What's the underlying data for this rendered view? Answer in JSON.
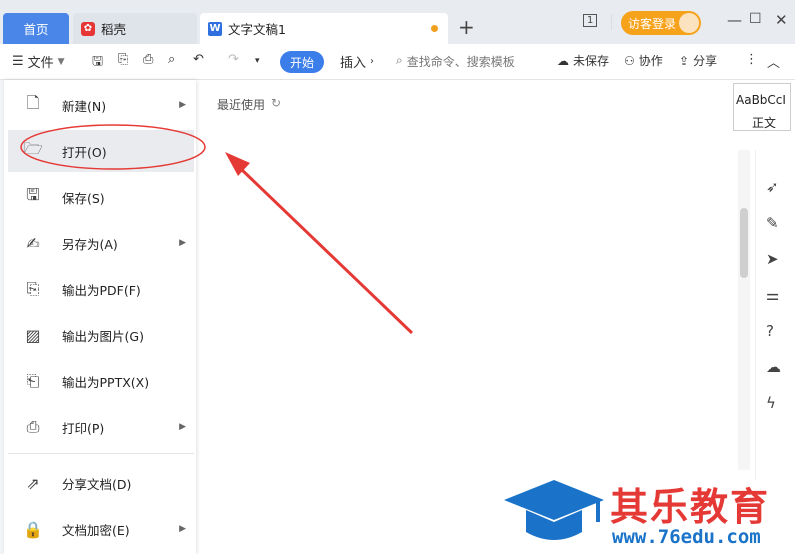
{
  "tabs": {
    "home": "首页",
    "daoke": "稻壳",
    "doc": "文字文稿1"
  },
  "header": {
    "visitor_label": "访客登录",
    "badge_count": "1"
  },
  "toolbar": {
    "file_label": "文件",
    "start_label": "开始",
    "insert_label": "插入",
    "search_placeholder": "查找命令、搜索模板",
    "unsaved_label": "未保存",
    "collab_label": "协作",
    "share_label": "分享"
  },
  "styles": {
    "preview": "AaBbCcI",
    "name": "正文"
  },
  "menu": {
    "items": [
      {
        "label": "新建(N)",
        "icon": "new-doc-icon",
        "submenu": true
      },
      {
        "label": "打开(O)",
        "icon": "folder-open-icon",
        "submenu": false
      },
      {
        "label": "保存(S)",
        "icon": "save-icon",
        "submenu": false
      },
      {
        "label": "另存为(A)",
        "icon": "save-as-icon",
        "submenu": true
      },
      {
        "label": "输出为PDF(F)",
        "icon": "pdf-icon",
        "submenu": false
      },
      {
        "label": "输出为图片(G)",
        "icon": "image-icon",
        "submenu": false
      },
      {
        "label": "输出为PPTX(X)",
        "icon": "pptx-icon",
        "submenu": false
      },
      {
        "label": "打印(P)",
        "icon": "print-icon",
        "submenu": true
      },
      {
        "label": "分享文档(D)",
        "icon": "share-icon",
        "submenu": false
      },
      {
        "label": "文档加密(E)",
        "icon": "lock-doc-icon",
        "submenu": true
      }
    ]
  },
  "recent": {
    "label": "最近使用"
  },
  "watermark": {
    "title": "其乐教育",
    "url": "www.76edu.com"
  },
  "colors": {
    "accent": "#3b7de9",
    "annotation": "#e53935"
  }
}
